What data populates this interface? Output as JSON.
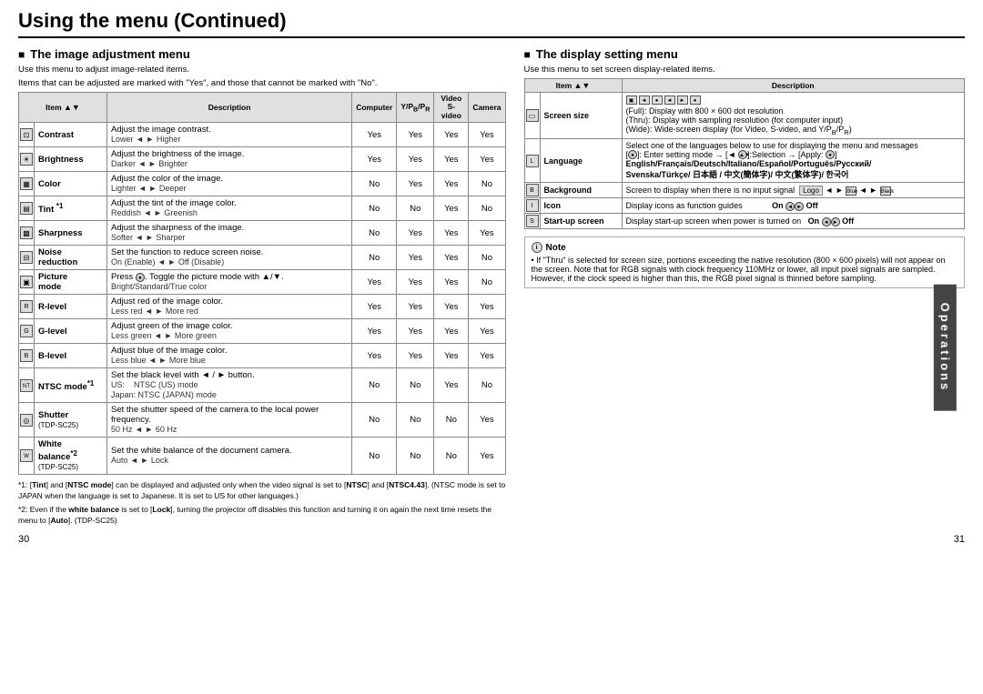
{
  "page": {
    "title": "Using the menu (Continued)",
    "page_left": "30",
    "page_right": "31",
    "operations_label": "Operations"
  },
  "left": {
    "section_title": "The image adjustment menu",
    "subtitle1": "Use this menu to adjust image-related items.",
    "subtitle2": "Items that can be adjusted are marked with \"Yes\", and those that cannot be marked with \"No\".",
    "table": {
      "headers": [
        "Item",
        "",
        "Description",
        "Computer",
        "Y/PB/PR",
        "Video S-video",
        "Camera"
      ],
      "rows": [
        {
          "item": "Contrast",
          "desc_main": "Adjust the image contrast.",
          "desc_sub": "Lower ◄ ► Higher",
          "computer": "Yes",
          "ypbpr": "Yes",
          "video": "Yes",
          "camera": "Yes"
        },
        {
          "item": "Brightness",
          "desc_main": "Adjust the brightness of the image.",
          "desc_sub": "Darker ◄ ► Brighter",
          "computer": "Yes",
          "ypbpr": "Yes",
          "video": "Yes",
          "camera": "Yes"
        },
        {
          "item": "Color",
          "desc_main": "Adjust the color of the image.",
          "desc_sub": "Lighter ◄ ► Deeper",
          "computer": "No",
          "ypbpr": "Yes",
          "video": "Yes",
          "camera": "No"
        },
        {
          "item": "Tint *1",
          "desc_main": "Adjust the tint of the image color.",
          "desc_sub": "Reddish ◄ ► Greenish",
          "computer": "No",
          "ypbpr": "No",
          "video": "Yes",
          "camera": "No"
        },
        {
          "item": "Sharpness",
          "desc_main": "Adjust the sharpness of the image.",
          "desc_sub": "Softer ◄ ► Sharper",
          "computer": "No",
          "ypbpr": "Yes",
          "video": "Yes",
          "camera": "Yes"
        },
        {
          "item": "Noise reduction",
          "desc_main": "Set the function to reduce screen noise.",
          "desc_sub": "On (Enable) ◄ ► Off (Disable)",
          "computer": "No",
          "ypbpr": "Yes",
          "video": "Yes",
          "camera": "No"
        },
        {
          "item": "Picture mode",
          "desc_main": "Press ●. Toggle the picture mode with ▲/▼.",
          "desc_sub": "Bright/Standard/True color",
          "computer": "Yes",
          "ypbpr": "Yes",
          "video": "Yes",
          "camera": "No"
        },
        {
          "item": "R-level",
          "desc_main": "Adjust red of the image color.",
          "desc_sub": "Less red ◄ ► More red",
          "computer": "Yes",
          "ypbpr": "Yes",
          "video": "Yes",
          "camera": "Yes"
        },
        {
          "item": "G-level",
          "desc_main": "Adjust green of the image color.",
          "desc_sub": "Less green ◄ ► More green",
          "computer": "Yes",
          "ypbpr": "Yes",
          "video": "Yes",
          "camera": "Yes"
        },
        {
          "item": "B-level",
          "desc_main": "Adjust blue of the image color.",
          "desc_sub": "Less blue ◄ ► More blue",
          "computer": "Yes",
          "ypbpr": "Yes",
          "video": "Yes",
          "camera": "Yes"
        },
        {
          "item": "NTSC mode*1",
          "desc_main": "Set the black level with ◄ / ► button.",
          "desc_sub": "US:    NTSC (US) mode\nJapan: NTSC (JAPAN) mode",
          "computer": "No",
          "ypbpr": "No",
          "video": "Yes",
          "camera": "No"
        },
        {
          "item": "Shutter",
          "item_sub": "(TDP-SC25)",
          "desc_main": "Set the shutter speed of the camera to the local power frequency.",
          "desc_sub": "50 Hz ◄ ► 60 Hz",
          "computer": "No",
          "ypbpr": "No",
          "video": "No",
          "camera": "Yes"
        },
        {
          "item": "White balance*2",
          "item_sub": "(TDP-SC25)",
          "desc_main": "Set the white balance of the document camera.",
          "desc_sub": "Auto ◄ ► Lock",
          "computer": "No",
          "ypbpr": "No",
          "video": "No",
          "camera": "Yes"
        }
      ]
    },
    "footnotes": [
      "*1: [Tint] and [NTSC mode] can be displayed and adjusted only when the video signal is set to [NTSC] and [NTSC4.43]. (NTSC mode is set to JAPAN when the language is set to Japanese. It is set to US for other languages.)",
      "*2: Even if the white balance is set to [Lock], turning the projector off disables this function and turning it on again the next time resets the menu to [Auto]. (TDP-SC25)"
    ]
  },
  "right": {
    "section_title": "The display setting menu",
    "subtitle": "Use this menu to set screen display-related items.",
    "table": {
      "headers": [
        "Item",
        "",
        "Description"
      ],
      "rows": [
        {
          "item": "Screen size",
          "desc": "(Full):  Display with 800 × 600 dot resolution\n(Thru): Display with sampling resolution (for computer input)\n(Wide): Wide-screen display (for Video, S-video, and Y/PB/PR)"
        },
        {
          "item": "Language",
          "desc": "Select one of the languages below to use for displaying the menu and messages\n[●]: Enter setting mode → [◄ ►]:Selection → [Apply: ●]\nEnglish/Français/Deutsch/Italiano/Español/Português/Русский/Svenska/Türkçe/ 日本語 / 中文(簡体字)/ 中文(繁体字)/ 한국어"
        },
        {
          "item": "Background",
          "desc": "Screen to display when there is no input signal   [Logo] ◄ ► [Blue] ◄ ► [Black]"
        },
        {
          "item": "Icon",
          "desc": "Display icons as function guides",
          "on_off": "On ◄ ► Off"
        },
        {
          "item": "Start-up screen",
          "desc": "Display start-up screen when power is turned on",
          "on_off": "On ◄ ► Off"
        }
      ]
    },
    "note": {
      "title": "Note",
      "content": "• If \"Thru\" is selected for screen size, portions exceeding the native resolution (800 × 600 pixels) will not appear on the screen. Note that for RGB signals with clock frequency 110MHz or lower, all input pixel signals are sampled. However, if the clock speed is higher than this, the RGB pixel signal is thinned before sampling."
    }
  }
}
